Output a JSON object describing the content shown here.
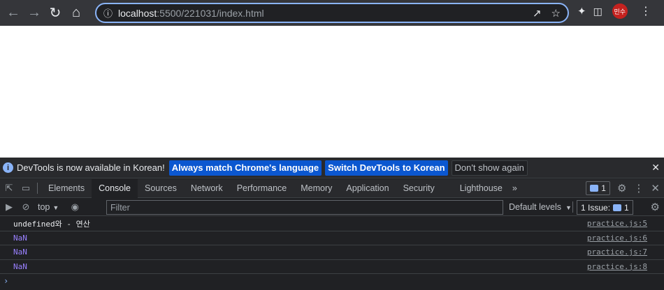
{
  "browser": {
    "url_host": "localhost",
    "url_rest": ":5500/221031/index.html",
    "profile_initials": "민수"
  },
  "infobar": {
    "message": "DevTools is now available in Korean!",
    "btn_match": "Always match Chrome's language",
    "btn_switch": "Switch DevTools to Korean",
    "btn_dismiss": "Don't show again"
  },
  "devtools": {
    "tabs": [
      "Elements",
      "Console",
      "Sources",
      "Network",
      "Performance",
      "Memory",
      "Application",
      "Security",
      "Lighthouse"
    ],
    "more": "»",
    "issue_count": "1"
  },
  "console_toolbar": {
    "context": "top",
    "filter_placeholder": "Filter",
    "levels": "Default levels",
    "issues_label": "1 Issue:",
    "issues_count": "1"
  },
  "logs": [
    {
      "text": "undefined와 - 연산",
      "source": "practice.js:5",
      "kind": "string"
    },
    {
      "text": "NaN",
      "source": "practice.js:6",
      "kind": "number"
    },
    {
      "text": "NaN",
      "source": "practice.js:7",
      "kind": "number"
    },
    {
      "text": "NaN",
      "source": "practice.js:8",
      "kind": "number"
    }
  ],
  "prompt_symbol": "›"
}
